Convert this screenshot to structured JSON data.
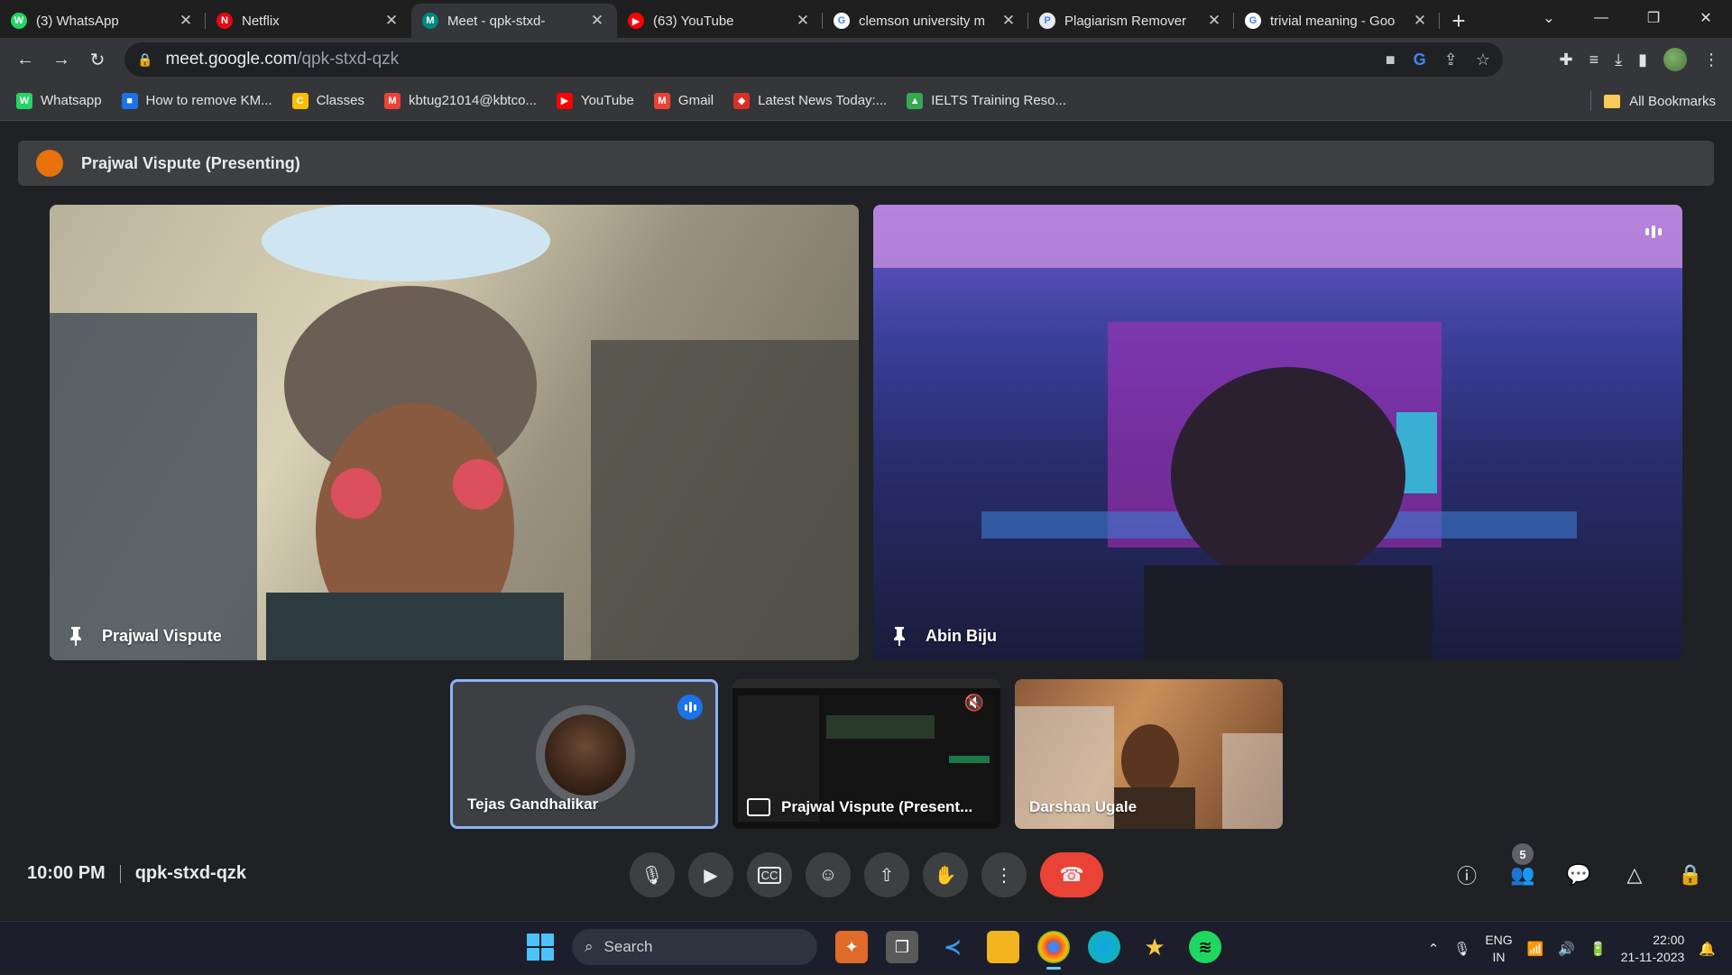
{
  "browser": {
    "tabs": [
      {
        "title": "(3) WhatsApp",
        "icon": "whatsapp-icon",
        "color": "#25d366",
        "glyph": "W"
      },
      {
        "title": "Netflix",
        "icon": "netflix-icon",
        "color": "#e50914",
        "glyph": "N"
      },
      {
        "title": "Meet - qpk-stxd-",
        "icon": "meet-icon",
        "color": "#00897b",
        "glyph": "M"
      },
      {
        "title": "(63) YouTube",
        "icon": "youtube-icon",
        "color": "#ff0000",
        "glyph": "▶"
      },
      {
        "title": "clemson university m",
        "icon": "google-icon",
        "color": "#ffffff",
        "glyph": "G"
      },
      {
        "title": "Plagiarism Remover",
        "icon": "plagiarism-icon",
        "color": "#e8eaed",
        "glyph": "P"
      },
      {
        "title": "trivial meaning - Goo",
        "icon": "google-icon",
        "color": "#ffffff",
        "glyph": "G"
      }
    ],
    "url_host": "meet.google.com",
    "url_path": "/qpk-stxd-qzk",
    "bookmarks": [
      {
        "label": "Whatsapp",
        "color": "#25d366",
        "glyph": "W"
      },
      {
        "label": "How to remove KM...",
        "color": "#1a73e8",
        "glyph": "■"
      },
      {
        "label": "Classes",
        "color": "#fbbc04",
        "glyph": "C"
      },
      {
        "label": "kbtug21014@kbtco...",
        "color": "#ea4335",
        "glyph": "M"
      },
      {
        "label": "YouTube",
        "color": "#ff0000",
        "glyph": "▶"
      },
      {
        "label": "Gmail",
        "color": "#ea4335",
        "glyph": "M"
      },
      {
        "label": "Latest News Today:...",
        "color": "#d93025",
        "glyph": "◆"
      },
      {
        "label": "IELTS Training Reso...",
        "color": "#34a853",
        "glyph": "▲"
      }
    ],
    "all_bookmarks": "All Bookmarks"
  },
  "meet": {
    "presenting_banner": "Prajwal Vispute (Presenting)",
    "main_tiles": [
      {
        "name": "Prajwal Vispute"
      },
      {
        "name": "Abin Biju"
      }
    ],
    "small_tiles": [
      {
        "name": "Tejas Gandhalikar"
      },
      {
        "name": "Prajwal Vispute (Present..."
      },
      {
        "name": "Darshan Ugale"
      }
    ],
    "time": "10:00 PM",
    "meeting_code": "qpk-stxd-qzk",
    "participant_count": "5"
  },
  "taskbar": {
    "search_placeholder": "Search",
    "lang_line1": "ENG",
    "lang_line2": "IN",
    "clock_time": "22:00",
    "clock_date": "21-11-2023"
  }
}
